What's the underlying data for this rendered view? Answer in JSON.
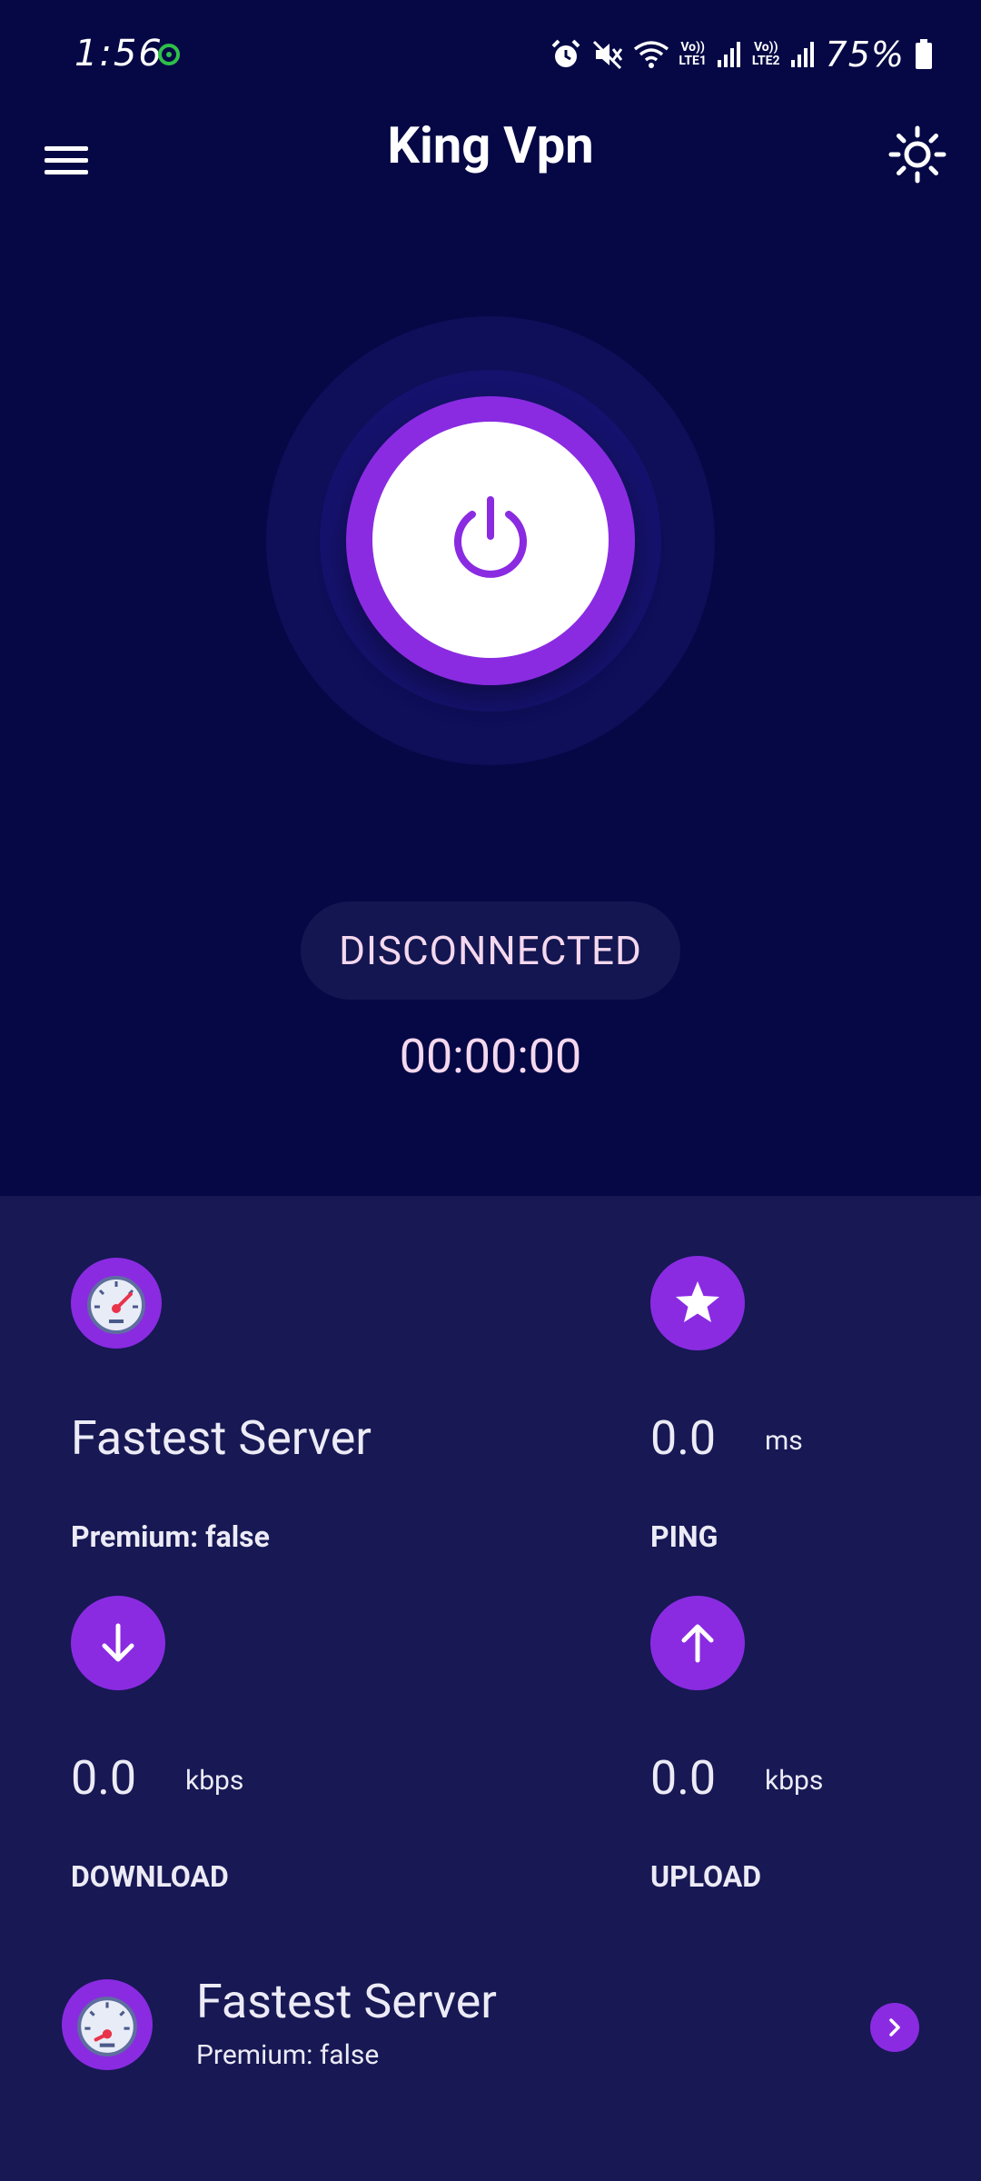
{
  "status_bar": {
    "time": "1:56",
    "battery": "75%",
    "sim1": {
      "top": "Vo))",
      "bottom": "LTE1"
    },
    "sim2": {
      "top": "Vo))",
      "bottom": "LTE2"
    }
  },
  "app": {
    "title": "King Vpn"
  },
  "connection": {
    "status": "DISCONNECTED",
    "timer": "00:00:00"
  },
  "stats": {
    "server": {
      "name": "Fastest Server",
      "premium": "Premium: false"
    },
    "ping": {
      "value": "0.0",
      "unit": "ms",
      "label": "PING"
    },
    "download": {
      "value": "0.0",
      "unit": "kbps",
      "label": "DOWNLOAD"
    },
    "upload": {
      "value": "0.0",
      "unit": "kbps",
      "label": "UPLOAD"
    }
  },
  "selected_server": {
    "name": "Fastest Server",
    "premium": "Premium: false"
  },
  "colors": {
    "background": "#050845",
    "panel": "#171854",
    "accent": "#8a2be2"
  },
  "icons": [
    "menu-icon",
    "brightness-icon",
    "power-icon",
    "speedometer-icon",
    "star-icon",
    "arrow-down-icon",
    "arrow-up-icon",
    "chevron-right-icon"
  ]
}
